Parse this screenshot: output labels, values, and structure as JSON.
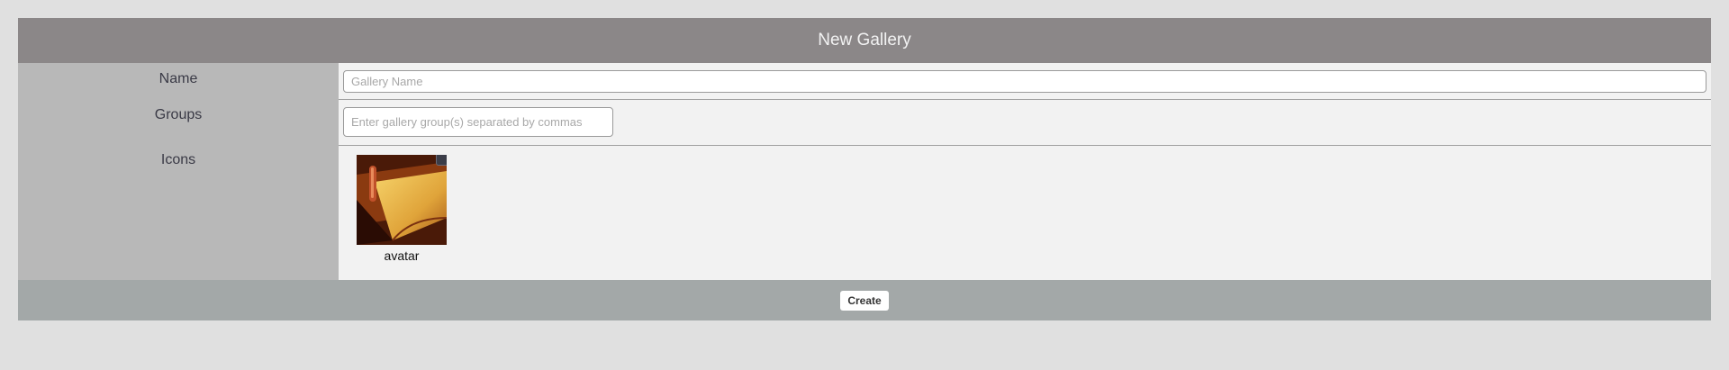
{
  "header": {
    "title": "New Gallery"
  },
  "form": {
    "name": {
      "label": "Name",
      "placeholder": "Gallery Name",
      "value": ""
    },
    "groups": {
      "label": "Groups",
      "placeholder": "Enter gallery group(s) separated by commas",
      "value": ""
    },
    "icons": {
      "label": "Icons",
      "items": [
        {
          "caption": "avatar",
          "selected": true
        }
      ]
    }
  },
  "footer": {
    "create_label": "Create"
  }
}
